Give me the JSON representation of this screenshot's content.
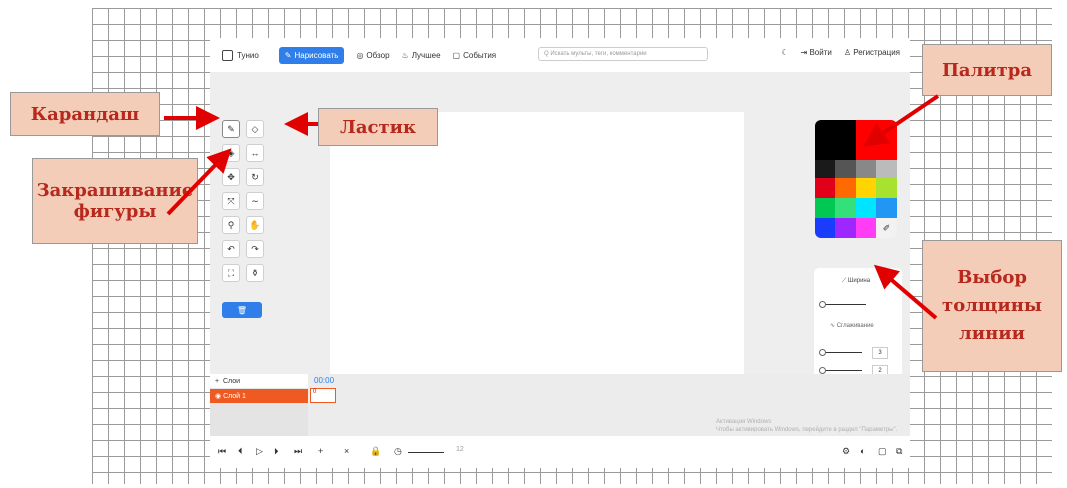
{
  "annotations": {
    "pencil": "Карандаш",
    "eraser": "Ластик",
    "fill_line1": "Закрашивание",
    "fill_line2": "фигуры",
    "palette": "Палитра",
    "width_line1": "Выбор",
    "width_line2": "толщины",
    "width_line3": "линии"
  },
  "header": {
    "logo": "Тунио",
    "nav": {
      "draw": "Нарисовать",
      "browse": "Обзор",
      "best": "Лучшее",
      "events": "События"
    },
    "search_placeholder": "Q Искать мульты, теги, комментарии",
    "login": "Войти",
    "register": "Регистрация"
  },
  "panel": {
    "width_label": "Ширина",
    "smoothing_label": "Сглаживание",
    "value_a": "3",
    "value_b": "2"
  },
  "layers": {
    "header": "Слои",
    "layer1": "Слой 1",
    "timecode": "00:00",
    "frame": "0"
  },
  "activation": {
    "line1": "Активация Windows",
    "line2": "Чтобы активировать Windows, перейдите в раздел \"Параметры\"."
  },
  "bottom": {
    "fps": "12"
  },
  "colors": {
    "accent": "#2f7ee9",
    "layer": "#ef5a23",
    "annotation_bg": "#f3cdb8",
    "annotation_text": "#b7281d",
    "arrow": "#e00000"
  }
}
